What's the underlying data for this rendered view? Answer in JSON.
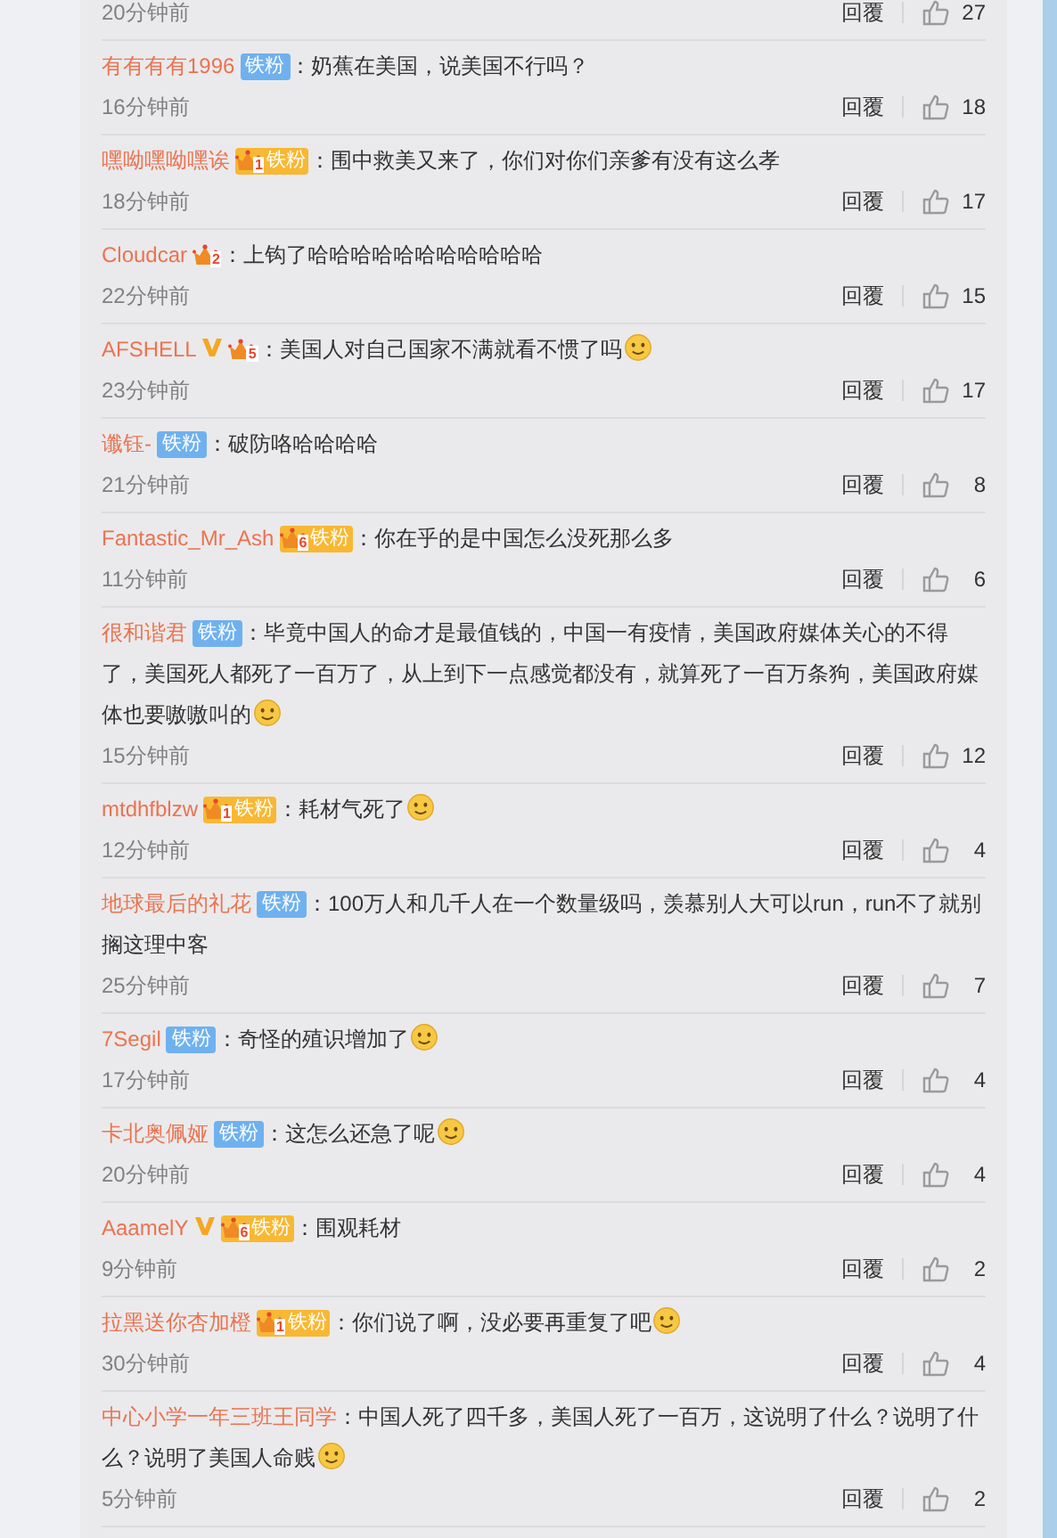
{
  "comments": [
    {
      "kind": "partial",
      "time": "20分钟前",
      "reply": "回覆",
      "likes": "27"
    },
    {
      "kind": "full",
      "user": "有有有有1996",
      "badges": [
        {
          "kind": "fan",
          "label": "铁粉"
        }
      ],
      "text": "：奶蕉在美国，说美国不行吗？",
      "emoji": false,
      "time": "16分钟前",
      "reply": "回覆",
      "likes": "18"
    },
    {
      "kind": "full",
      "user": "嘿呦嘿呦嘿诶",
      "badges": [
        {
          "kind": "crown",
          "level": "1",
          "label": "铁粉"
        }
      ],
      "text": "：围中救美又来了，你们对你们亲爹有没有这么孝",
      "emoji": false,
      "time": "18分钟前",
      "reply": "回覆",
      "likes": "17"
    },
    {
      "kind": "full",
      "user": "Cloudcar",
      "badges": [
        {
          "kind": "crown",
          "level": "2"
        }
      ],
      "text": "：上钩了哈哈哈哈哈哈哈哈哈哈哈",
      "emoji": false,
      "time": "22分钟前",
      "reply": "回覆",
      "likes": "15"
    },
    {
      "kind": "full",
      "user": "AFSHELL",
      "badges": [
        {
          "kind": "verified"
        },
        {
          "kind": "crown",
          "level": "5"
        }
      ],
      "text": "：美国人对自己国家不满就看不惯了吗",
      "emoji": true,
      "time": "23分钟前",
      "reply": "回覆",
      "likes": "17"
    },
    {
      "kind": "full",
      "user": "谶钰-",
      "badges": [
        {
          "kind": "fan",
          "label": "铁粉"
        }
      ],
      "text": "：破防咯哈哈哈哈",
      "emoji": false,
      "time": "21分钟前",
      "reply": "回覆",
      "likes": "8"
    },
    {
      "kind": "full",
      "user": "Fantastic_Mr_Ash",
      "badges": [
        {
          "kind": "crown",
          "level": "6",
          "label": "铁粉"
        }
      ],
      "text": "：你在乎的是中国怎么没死那么多",
      "emoji": false,
      "time": "11分钟前",
      "reply": "回覆",
      "likes": "6"
    },
    {
      "kind": "full",
      "user": "很和谐君",
      "badges": [
        {
          "kind": "fan",
          "label": "铁粉"
        }
      ],
      "text": "：毕竟中国人的命才是最值钱的，中国一有疫情，美国政府媒体关心的不得了，美国死人都死了一百万了，从上到下一点感觉都没有，就算死了一百万条狗，美国政府媒体也要嗷嗷叫的",
      "emoji": true,
      "time": "15分钟前",
      "reply": "回覆",
      "likes": "12"
    },
    {
      "kind": "full",
      "user": "mtdhfblzw",
      "badges": [
        {
          "kind": "crown",
          "level": "1",
          "label": "铁粉"
        }
      ],
      "text": "：耗材气死了",
      "emoji": true,
      "time": "12分钟前",
      "reply": "回覆",
      "likes": "4"
    },
    {
      "kind": "full",
      "user": "地球最后的礼花",
      "badges": [
        {
          "kind": "fan",
          "label": "铁粉"
        }
      ],
      "text": "：100万人和几千人在一个数量级吗，羡慕别人大可以run，run不了就别搁这理中客",
      "emoji": false,
      "time": "25分钟前",
      "reply": "回覆",
      "likes": "7"
    },
    {
      "kind": "full",
      "user": "7Segil",
      "badges": [
        {
          "kind": "fan",
          "label": "铁粉"
        }
      ],
      "text": "：奇怪的殖识增加了",
      "emoji": true,
      "time": "17分钟前",
      "reply": "回覆",
      "likes": "4"
    },
    {
      "kind": "full",
      "user": "卡北奥佩娅",
      "badges": [
        {
          "kind": "fan",
          "label": "铁粉"
        }
      ],
      "text": "：这怎么还急了呢",
      "emoji": true,
      "time": "20分钟前",
      "reply": "回覆",
      "likes": "4"
    },
    {
      "kind": "full",
      "user": "AaamelY",
      "badges": [
        {
          "kind": "verified"
        },
        {
          "kind": "crown",
          "level": "6",
          "label": "铁粉"
        }
      ],
      "text": "：围观耗材",
      "emoji": false,
      "time": "9分钟前",
      "reply": "回覆",
      "likes": "2"
    },
    {
      "kind": "full",
      "user": "拉黑送你杏加橙",
      "badges": [
        {
          "kind": "crown",
          "level": "1",
          "label": "铁粉"
        }
      ],
      "text": "：你们说了啊，没必要再重复了吧",
      "emoji": true,
      "time": "30分钟前",
      "reply": "回覆",
      "likes": "4"
    },
    {
      "kind": "full",
      "user": "中心小学一年三班王同学",
      "text": "：中国人死了四千多，美国人死了一百万，这说明了什么？说明了什么？说明了美国人命贱",
      "emoji": true,
      "time": "5分钟前",
      "reply": "回覆",
      "likes": "2"
    }
  ]
}
